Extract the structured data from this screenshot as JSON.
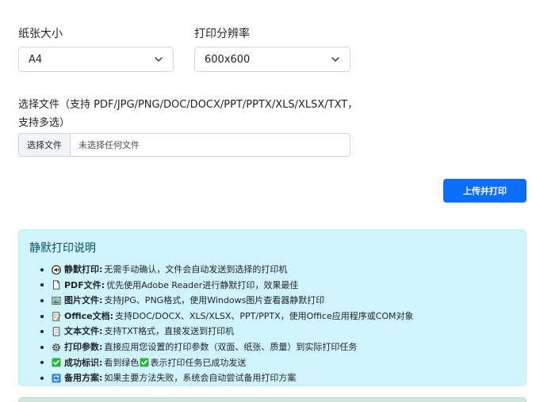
{
  "paper": {
    "label": "纸张大小",
    "value": "A4"
  },
  "resolution": {
    "label": "打印分辨率",
    "value": "600x600"
  },
  "file": {
    "label": "选择文件（支持 PDF/JPG/PNG/DOC/DOCX/PPT/PPTX/XLS/XLSX/TXT，支持多选）",
    "button": "选择文件",
    "status": "未选择任何文件"
  },
  "upload_button": "上传并打印",
  "info": {
    "title": "静默打印说明",
    "items": [
      {
        "icon": "speaker-muted-icon",
        "bold": "静默打印:",
        "text": "无需手动确认，文件会自动发送到选择的打印机"
      },
      {
        "icon": "document-icon",
        "bold": "PDF文件:",
        "text": "优先使用Adobe Reader进行静默打印，效果最佳"
      },
      {
        "icon": "picture-icon",
        "bold": "图片文件:",
        "text": "支持JPG、PNG格式，使用Windows图片查看器静默打印"
      },
      {
        "icon": "memo-icon",
        "bold": "Office文档:",
        "text": "支持DOC/DOCX、XLS/XLSX、PPT/PPTX，使用Office应用程序或COM对象"
      },
      {
        "icon": "page-icon",
        "bold": "文本文件:",
        "text": "支持TXT格式，直接发送到打印机"
      },
      {
        "icon": "gear-icon",
        "bold": "打印参数:",
        "text": "直接应用您设置的打印参数（双面、纸张、质量）到实际打印任务"
      },
      {
        "icon": "check-mark-icon",
        "bold": "成功标识:",
        "text_before": "看到绿色",
        "text_after": "表示打印任务已成功发送"
      },
      {
        "icon": "repeat-icon",
        "bold": "备用方案:",
        "text": "如果主要方法失败，系统会自动尝试备用打印方案"
      }
    ]
  },
  "colors": {
    "primary": "#0d6efd",
    "info_bg": "#cff4fc",
    "info_text": "#055160",
    "success": "#2fb344"
  }
}
